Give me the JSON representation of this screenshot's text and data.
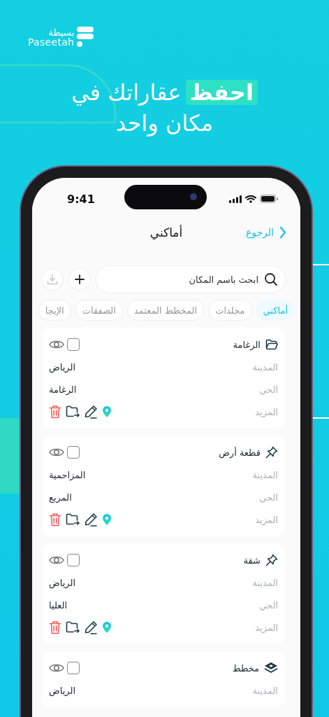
{
  "brand": {
    "arabic_name": "بسيطة",
    "latin_name": "Paseetah"
  },
  "headline": {
    "highlight": "احفظ",
    "line_1_rest": "عقاراتك في",
    "line_2": "مكان واحد"
  },
  "status_bar": {
    "time": "9:41"
  },
  "nav": {
    "back": "الرجوع",
    "title": "أماكني"
  },
  "search": {
    "placeholder": "ابحث باسم المكان"
  },
  "tabs": [
    {
      "label": "أماكني",
      "selected": true
    },
    {
      "label": "مجلدات",
      "selected": false
    },
    {
      "label": "المخطط المعتمد",
      "selected": false
    },
    {
      "label": "الصفقات",
      "selected": false
    },
    {
      "label": "الإيجا",
      "selected": false
    }
  ],
  "cards": [
    {
      "kind": "folder",
      "title": "الرغامة",
      "checked": false,
      "fields": [
        {
          "label": "المدينة",
          "value": "الرياض"
        },
        {
          "label": "الحي",
          "value": "الرغامة"
        }
      ],
      "more_label": "المزيد"
    },
    {
      "kind": "pin",
      "title": "قطعة أرض",
      "checked": false,
      "fields": [
        {
          "label": "المدينة",
          "value": "المزاحمية"
        },
        {
          "label": "الحي",
          "value": "المربع"
        }
      ],
      "more_label": "المزيد"
    },
    {
      "kind": "pin",
      "title": "شقة",
      "checked": false,
      "fields": [
        {
          "label": "المدينة",
          "value": "الرياض"
        },
        {
          "label": "الحي",
          "value": "العليا"
        }
      ],
      "more_label": "المزيد"
    },
    {
      "kind": "plan",
      "title": "مخطط",
      "checked": false,
      "fields": [
        {
          "label": "المدينة",
          "value": "الرياض"
        }
      ]
    }
  ]
}
